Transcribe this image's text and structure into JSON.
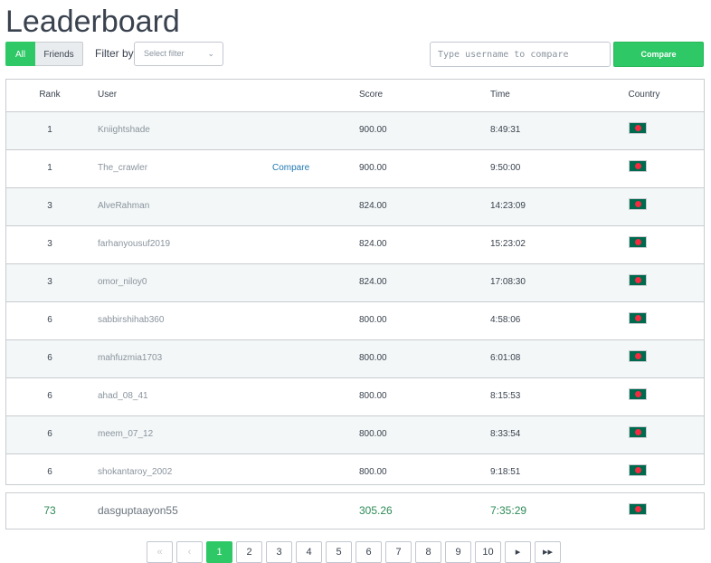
{
  "title": "Leaderboard",
  "toggle": {
    "all": "All",
    "friends": "Friends"
  },
  "filter": {
    "label": "Filter by",
    "placeholder": "Select filter"
  },
  "compare": {
    "placeholder": "Type username to compare",
    "button": "Compare"
  },
  "table": {
    "headers": {
      "rank": "Rank",
      "user": "User",
      "score": "Score",
      "time": "Time",
      "country": "Country"
    },
    "rows": [
      {
        "rank": "1",
        "user": "Kniightshade",
        "compare": "",
        "score": "900.00",
        "time": "8:49:31"
      },
      {
        "rank": "1",
        "user": "The_crawler",
        "compare": "Compare",
        "score": "900.00",
        "time": "9:50:00"
      },
      {
        "rank": "3",
        "user": "AlveRahman",
        "compare": "",
        "score": "824.00",
        "time": "14:23:09"
      },
      {
        "rank": "3",
        "user": "farhanyousuf2019",
        "compare": "",
        "score": "824.00",
        "time": "15:23:02"
      },
      {
        "rank": "3",
        "user": "omor_niloy0",
        "compare": "",
        "score": "824.00",
        "time": "17:08:30"
      },
      {
        "rank": "6",
        "user": "sabbirshihab360",
        "compare": "",
        "score": "800.00",
        "time": "4:58:06"
      },
      {
        "rank": "6",
        "user": "mahfuzmia1703",
        "compare": "",
        "score": "800.00",
        "time": "6:01:08"
      },
      {
        "rank": "6",
        "user": "ahad_08_41",
        "compare": "",
        "score": "800.00",
        "time": "8:15:53"
      },
      {
        "rank": "6",
        "user": "meem_07_12",
        "compare": "",
        "score": "800.00",
        "time": "8:33:54"
      },
      {
        "rank": "6",
        "user": "shokantaroy_2002",
        "compare": "",
        "score": "800.00",
        "time": "9:18:51"
      }
    ]
  },
  "my_row": {
    "rank": "73",
    "user": "dasguptaayon55",
    "score": "305.26",
    "time": "7:35:29"
  },
  "pagination": {
    "pages": [
      "1",
      "2",
      "3",
      "4",
      "5",
      "6",
      "7",
      "8",
      "9",
      "10"
    ],
    "current": "1"
  },
  "icons": {
    "flag": "bangladesh-flag-icon",
    "first": "first-page-icon",
    "prev": "prev-page-icon",
    "next": "next-page-icon",
    "last": "last-page-icon"
  },
  "colors": {
    "accent": "#2ec866",
    "link": "#1e77b3",
    "my_row_text": "#2e8b57"
  }
}
